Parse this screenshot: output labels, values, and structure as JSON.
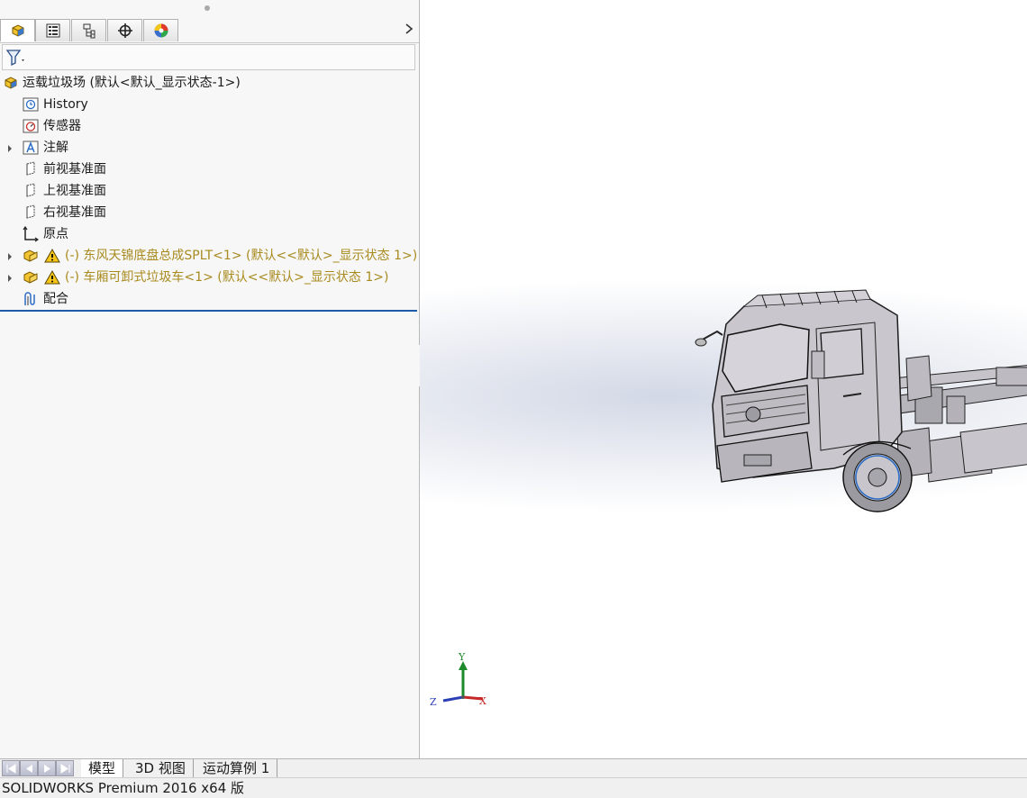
{
  "tree": {
    "root_label": "运载垃圾场  (默认<默认_显示状态-1>)",
    "items": [
      {
        "label": "History"
      },
      {
        "label": "传感器"
      },
      {
        "label": "注解"
      },
      {
        "label": "前视基准面"
      },
      {
        "label": "上视基准面"
      },
      {
        "label": "右视基准面"
      },
      {
        "label": "原点"
      },
      {
        "label": "(-) 东风天锦底盘总成SPLT<1> (默认<<默认>_显示状态 1>)"
      },
      {
        "label": "(-) 车厢可卸式垃圾车<1> (默认<<默认>_显示状态 1>)"
      },
      {
        "label": "配合"
      }
    ]
  },
  "triad": {
    "x_label": "X",
    "y_label": "Y",
    "z_label": "Z"
  },
  "bottom_tabs": [
    {
      "label": "模型"
    },
    {
      "label": "3D 视图"
    },
    {
      "label": "运动算例 1"
    }
  ],
  "status_bar": {
    "text": "SOLIDWORKS Premium 2016 x64 版"
  },
  "colors": {
    "selection_blue": "#1f5aa8",
    "warning_text": "#a88a1e",
    "part_yellow": "#e6b400"
  }
}
